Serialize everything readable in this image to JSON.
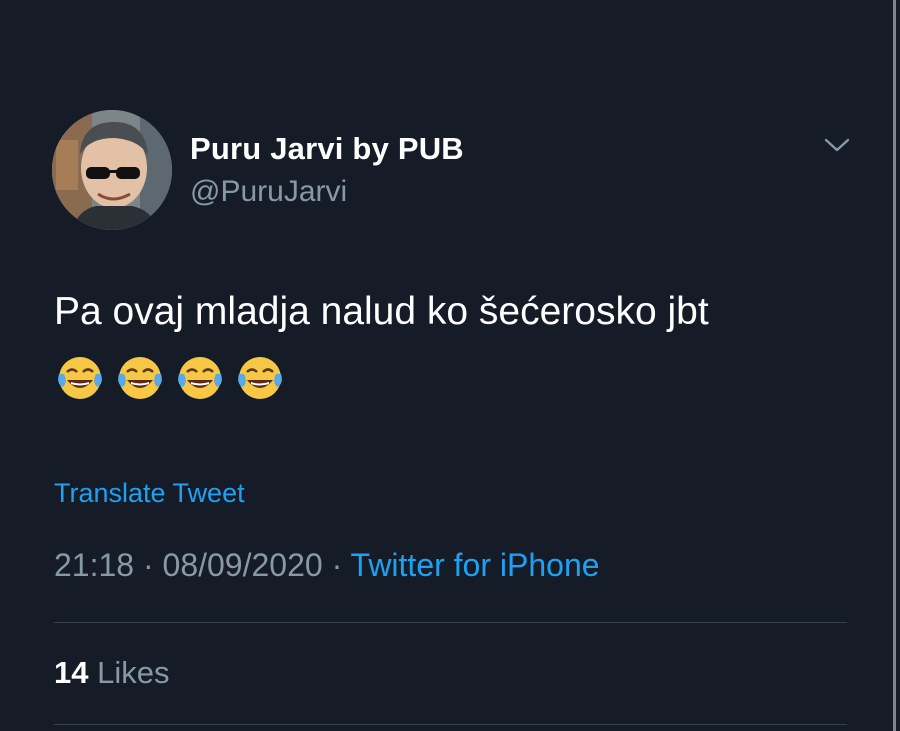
{
  "tweet": {
    "author": {
      "display_name": "Puru Jarvi by PUB",
      "handle": "@PuruJarvi",
      "avatar_icon": "avatar-photo"
    },
    "text": "Pa ovaj mladja nalud ko šećerosko jbt",
    "emojis": [
      "😂",
      "😂",
      "😂",
      "😂"
    ],
    "translate_label": "Translate Tweet",
    "time": "21:18",
    "separator": " · ",
    "date": "08/09/2020",
    "source": "Twitter for iPhone",
    "likes": {
      "count": "14",
      "label": "Likes"
    },
    "menu_icon": "chevron-down-icon"
  },
  "colors": {
    "background": "#151c27",
    "text_primary": "#ffffff",
    "text_secondary": "#8899a6",
    "link": "#1da1f2",
    "divider": "#38444d"
  }
}
